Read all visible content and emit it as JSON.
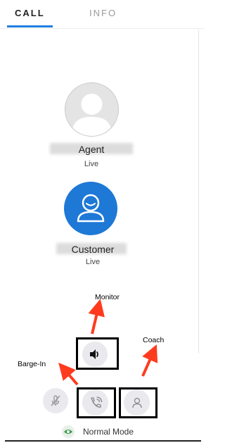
{
  "tabs": {
    "call": "CALL",
    "info": "INFO"
  },
  "participants": {
    "agent": {
      "name": "Agent",
      "status": "Live"
    },
    "customer": {
      "name": "Customer",
      "status": "Live"
    }
  },
  "annotations": {
    "monitor": "Monitor",
    "coach": "Coach",
    "barge_in": "Barge-In"
  },
  "controls": {
    "mode_label": "Normal Mode"
  },
  "colors": {
    "accent": "#1f7fe0",
    "customer_avatar": "#1e78d6",
    "arrow": "#ff3b1f",
    "mode_icon": "#3a9a48"
  }
}
